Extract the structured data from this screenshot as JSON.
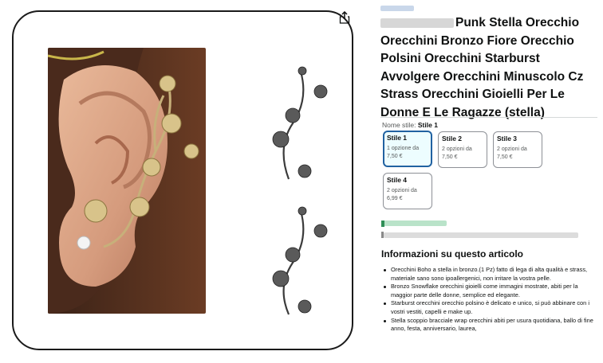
{
  "product": {
    "title": "Punk Stella Orecchio Orecchini Bronzo Fiore Orecchio Polsini Orecchini Starburst Avvolgere Orecchini Minuscolo Cz Strass Orecchini Gioielli Per Le Donne E Le Ragazze (stella)",
    "image_icons": {
      "share": "share-icon"
    }
  },
  "style_selector": {
    "label_prefix": "Nome stile:",
    "selected_value": "Stile 1",
    "options": [
      {
        "name": "Stile 1",
        "options_text": "1 opzione da",
        "price": "7,50 €",
        "selected": true
      },
      {
        "name": "Stile 2",
        "options_text": "2 opzioni da",
        "price": "7,50 €",
        "selected": false
      },
      {
        "name": "Stile 3",
        "options_text": "2 opzioni da",
        "price": "7,50 €",
        "selected": false
      },
      {
        "name": "Stile 4",
        "options_text": "2 opzioni da",
        "price": "6,99 €",
        "selected": false
      }
    ]
  },
  "info": {
    "heading": "Informazioni su questo articolo",
    "bullets": [
      "Orecchini Boho a stella in bronzo.(1 Pz) fatto di lega di alta qualità e strass, materiale sano sono ipoallergenici, non irritare la vostra pelle.",
      "Bronzo Snowflake orecchini gioielli come immagini mostrate, abiti per la maggior parte delle donne, semplice ed elegante.",
      "Starburst orecchini orecchio polsino è delicato e unico, si può abbinare con i vostri vestiti, capelli e make up.",
      "Stella scoppio bracciale wrap orecchini abiti per usura quotidiana, ballo di fine anno, festa, anniversario, laurea,"
    ]
  },
  "colors": {
    "selected_border": "#2162a1",
    "selected_bg": "#edfdff",
    "text": "#0f1111",
    "muted": "#565959"
  }
}
